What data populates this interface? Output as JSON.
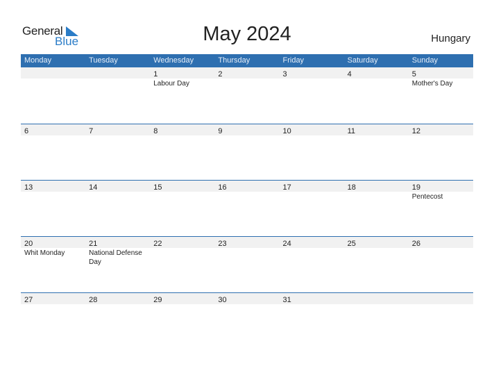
{
  "logo": {
    "word1": "General",
    "word2": "Blue"
  },
  "title": "May 2024",
  "country": "Hungary",
  "colors": {
    "header_bg": "#2e6fb0",
    "date_strip": "#f1f1f1",
    "logo_blue": "#2a7cc7"
  },
  "weekdays": [
    "Monday",
    "Tuesday",
    "Wednesday",
    "Thursday",
    "Friday",
    "Saturday",
    "Sunday"
  ],
  "weeks": [
    {
      "days": [
        "",
        "",
        "1",
        "2",
        "3",
        "4",
        "5"
      ],
      "events": [
        "",
        "",
        "Labour Day",
        "",
        "",
        "",
        "Mother's Day"
      ]
    },
    {
      "days": [
        "6",
        "7",
        "8",
        "9",
        "10",
        "11",
        "12"
      ],
      "events": [
        "",
        "",
        "",
        "",
        "",
        "",
        ""
      ]
    },
    {
      "days": [
        "13",
        "14",
        "15",
        "16",
        "17",
        "18",
        "19"
      ],
      "events": [
        "",
        "",
        "",
        "",
        "",
        "",
        "Pentecost"
      ]
    },
    {
      "days": [
        "20",
        "21",
        "22",
        "23",
        "24",
        "25",
        "26"
      ],
      "events": [
        "Whit Monday",
        "National Defense Day",
        "",
        "",
        "",
        "",
        ""
      ]
    },
    {
      "days": [
        "27",
        "28",
        "29",
        "30",
        "31",
        "",
        ""
      ],
      "events": [
        "",
        "",
        "",
        "",
        "",
        "",
        ""
      ]
    }
  ]
}
